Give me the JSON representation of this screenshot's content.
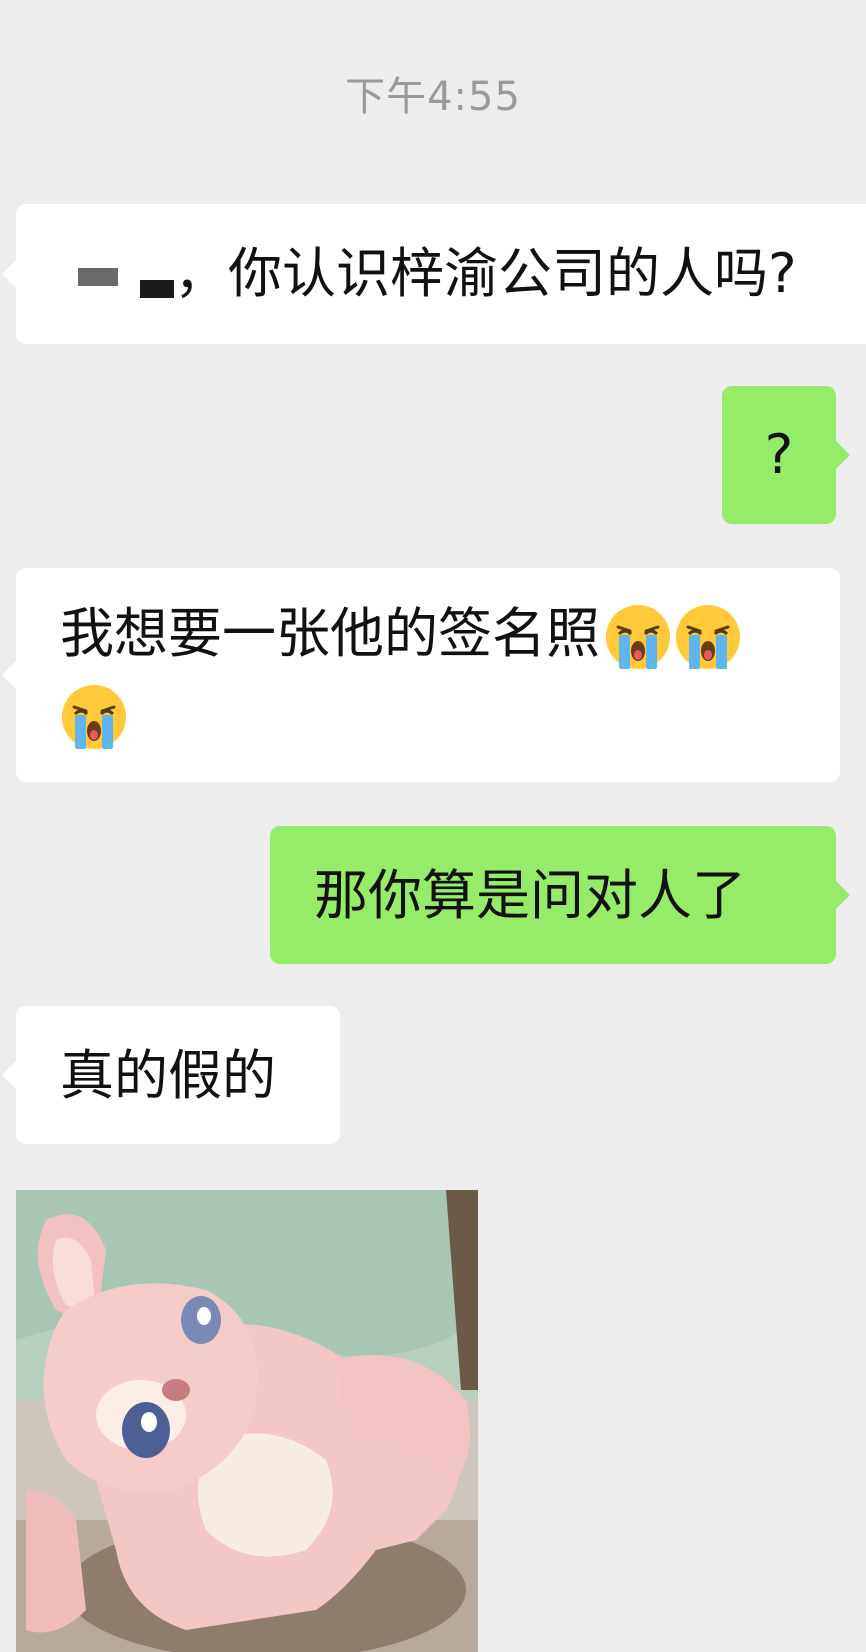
{
  "chat": {
    "timestamp": "下午4:55",
    "messages": [
      {
        "side": "left",
        "text": "，你认识梓渝公司的人吗?"
      },
      {
        "side": "right",
        "text": "?"
      },
      {
        "side": "left",
        "text": "我想要一张他的签名照",
        "emoji": [
          "loudly-crying-face",
          "loudly-crying-face",
          "loudly-crying-face"
        ]
      },
      {
        "side": "right",
        "text": "那你算是问对人了"
      },
      {
        "side": "left",
        "text": "真的假的"
      },
      {
        "side": "left",
        "type": "sticker",
        "sticker": "pink-fox-mascot-sticker"
      }
    ]
  },
  "colors": {
    "background": "#ededed",
    "incoming_bubble": "#ffffff",
    "outgoing_bubble": "#95ec69",
    "timestamp_text": "#9a9a9a"
  }
}
